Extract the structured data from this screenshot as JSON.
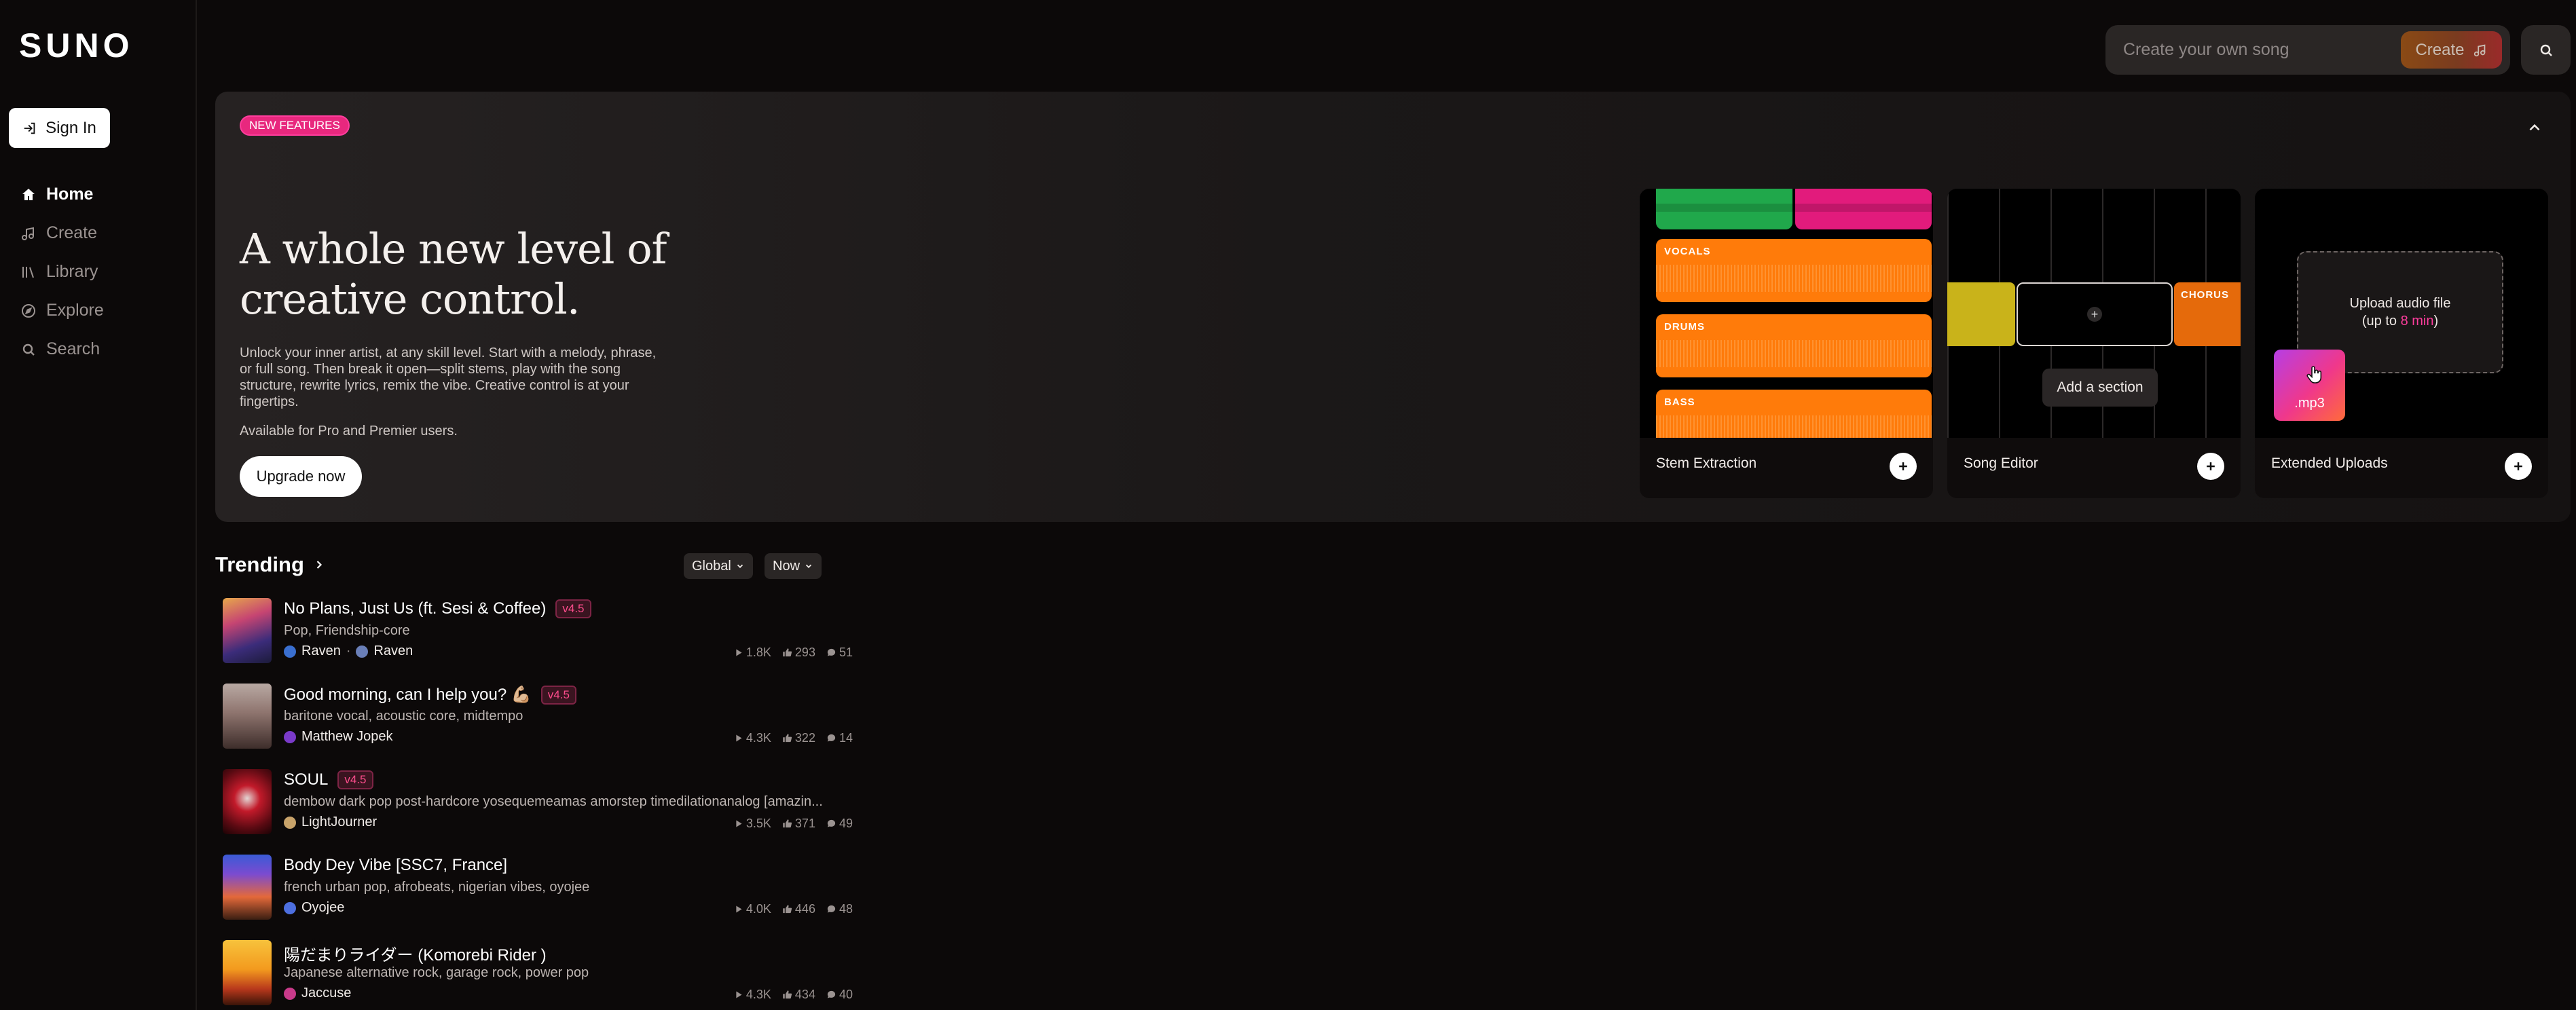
{
  "app": {
    "logo": "SUNO"
  },
  "sidebar": {
    "sign_in_label": "Sign In",
    "items": [
      {
        "label": "Home",
        "icon": "home-icon",
        "active": true
      },
      {
        "label": "Create",
        "icon": "music-note-icon",
        "active": false
      },
      {
        "label": "Library",
        "icon": "library-icon",
        "active": false
      },
      {
        "label": "Explore",
        "icon": "compass-icon",
        "active": false
      },
      {
        "label": "Search",
        "icon": "search-icon",
        "active": false
      }
    ]
  },
  "topbar": {
    "placeholder": "Create your own song",
    "create_label": "Create"
  },
  "banner": {
    "badge": "NEW FEATURES",
    "headline_line1": "A whole new level of",
    "headline_line2": "creative control.",
    "description": "Unlock your inner artist, at any skill level. Start with a melody, phrase, or full song. Then break it open—split stems, play with the song structure, rewrite lyrics, remix the vibe. Creative control is at your fingertips.",
    "availability": "Available for Pro and Premier users.",
    "cta": "Upgrade now",
    "cards": [
      {
        "title": "Stem Extraction",
        "tracks": [
          "VOCALS",
          "DRUMS",
          "BASS"
        ]
      },
      {
        "title": "Song Editor",
        "section_label": "CHORUS",
        "tooltip": "Add a section"
      },
      {
        "title": "Extended Uploads",
        "upload_line1": "Upload audio file",
        "upload_line2_prefix": "(up to ",
        "upload_line2_highlight": "8 min",
        "upload_line2_suffix": ")",
        "file_label": ".mp3"
      }
    ],
    "colors": {
      "accent_pink": "#e8287e",
      "stem_orange": "#ff7b0a",
      "stem_green": "#20a84b"
    }
  },
  "trending": {
    "title": "Trending",
    "filters": [
      "Global",
      "Now"
    ],
    "songs": [
      {
        "title": "No Plans, Just Us (ft. Sesi & Coffee)",
        "version": "v4.5",
        "tags": "Pop, Friendship-core",
        "artist": "Raven",
        "artist2": "Raven",
        "plays": "1.8K",
        "likes": "293",
        "comments": "51"
      },
      {
        "title": "Good morning, can I help you? 💪🏼",
        "version": "v4.5",
        "tags": "baritone vocal, acoustic core, midtempo",
        "artist": "Matthew Jopek",
        "plays": "4.3K",
        "likes": "322",
        "comments": "14"
      },
      {
        "title": "SOUL",
        "version": "v4.5",
        "tags": "dembow dark pop post-hardcore yosequemeamas amorstep timedilationanalog [amazin...",
        "artist": "LightJourner",
        "plays": "3.5K",
        "likes": "371",
        "comments": "49"
      },
      {
        "title": "Body Dey Vibe [SSC7, France]",
        "version": "",
        "tags": "french urban pop, afrobeats, nigerian vibes, oyojee",
        "artist": "Oyojee",
        "plays": "4.0K",
        "likes": "446",
        "comments": "48"
      },
      {
        "title": "陽だまりライダー (Komorebi Rider )",
        "version": "",
        "tags": "Japanese alternative rock, garage rock, power pop",
        "artist": "Jaccuse",
        "plays": "4.3K",
        "likes": "434",
        "comments": "40"
      }
    ]
  }
}
